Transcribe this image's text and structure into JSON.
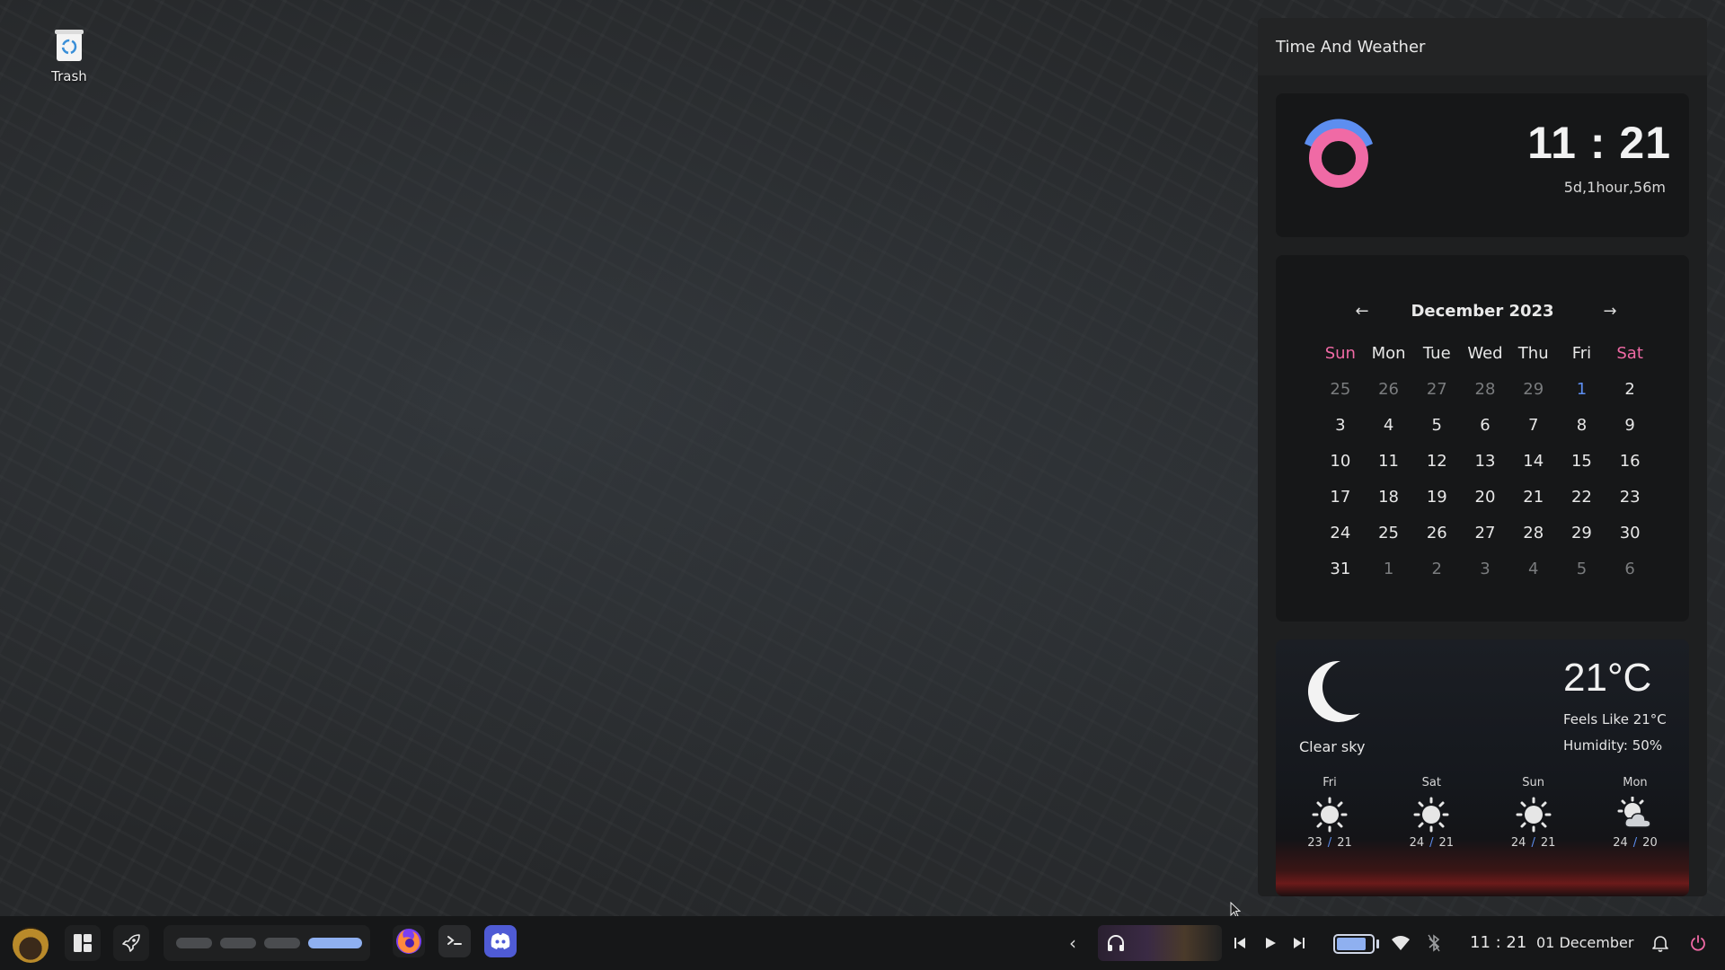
{
  "desktop": {
    "icons": [
      {
        "label": "Trash",
        "icon": "trash-icon"
      }
    ]
  },
  "panel": {
    "title": "Time And Weather",
    "clock": {
      "time": "11 : 21",
      "uptime": "5d,1hour,56m",
      "ring_colors": {
        "outer": "#5d8ef0",
        "inner": "#f06aa5"
      }
    },
    "calendar": {
      "title": "December 2023",
      "prev_icon": "arrow-left-icon",
      "next_icon": "arrow-right-icon",
      "weekdays": [
        "Sun",
        "Mon",
        "Tue",
        "Wed",
        "Thu",
        "Fri",
        "Sat"
      ],
      "weeks": [
        [
          "25",
          "26",
          "27",
          "28",
          "29",
          "1",
          "2"
        ],
        [
          "3",
          "4",
          "5",
          "6",
          "7",
          "8",
          "9"
        ],
        [
          "10",
          "11",
          "12",
          "13",
          "14",
          "15",
          "16"
        ],
        [
          "17",
          "18",
          "19",
          "20",
          "21",
          "22",
          "23"
        ],
        [
          "24",
          "25",
          "26",
          "27",
          "28",
          "29",
          "30"
        ],
        [
          "31",
          "1",
          "2",
          "3",
          "4",
          "5",
          "6"
        ]
      ],
      "today": "1",
      "weekend_color": "#f06aa5",
      "today_color": "#5d8ef0"
    },
    "weather": {
      "condition": "Clear sky",
      "condition_icon": "moon-icon",
      "temperature": "21°C",
      "feels_like": "Feels Like 21°C",
      "humidity": "Humidity: 50%",
      "forecast": [
        {
          "day": "Fri",
          "icon": "sun-icon",
          "high": "23",
          "low": "21"
        },
        {
          "day": "Sat",
          "icon": "sun-icon",
          "high": "24",
          "low": "21"
        },
        {
          "day": "Sun",
          "icon": "sun-icon",
          "high": "24",
          "low": "21"
        },
        {
          "day": "Mon",
          "icon": "cloud-sun-icon",
          "high": "24",
          "low": "20"
        }
      ],
      "separator": "/"
    }
  },
  "taskbar": {
    "left_icons": [
      "avatar",
      "layout-icon",
      "rocket-icon"
    ],
    "workspaces": [
      {
        "active": false
      },
      {
        "active": false
      },
      {
        "active": false
      },
      {
        "active": true
      }
    ],
    "apps": [
      "firefox-icon",
      "terminal-icon",
      "discord-icon"
    ],
    "tray_icons": [
      "chevron-left-icon",
      "headphones-icon",
      "previous-icon",
      "play-icon",
      "next-icon",
      "wifi-icon",
      "bluetooth-icon",
      "bell-icon",
      "power-icon"
    ],
    "battery_level": 0.85,
    "time": "11 : 21",
    "date": "01 December",
    "accent": "#8fb0f0",
    "power_color": "#f06aa5"
  }
}
